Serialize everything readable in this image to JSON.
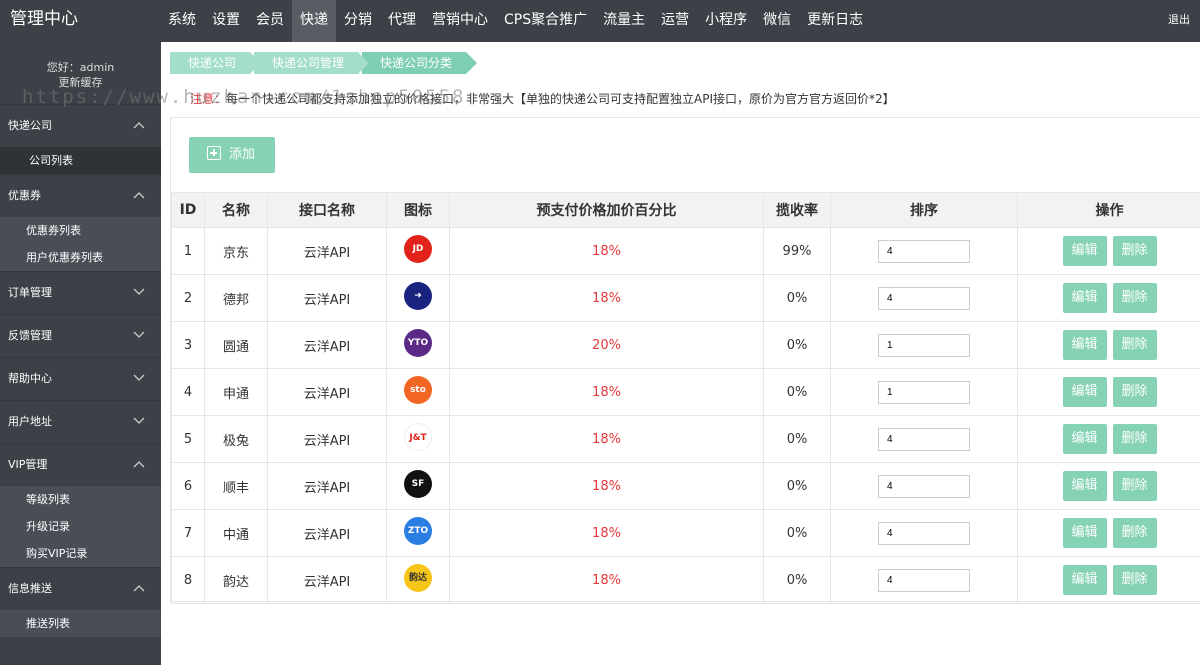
{
  "header": {
    "brand": "管理中心",
    "nav": [
      "系统",
      "设置",
      "会员",
      "快递",
      "分销",
      "代理",
      "营销中心",
      "CPS聚合推广",
      "流量主",
      "运营",
      "小程序",
      "微信",
      "更新日志"
    ],
    "active_nav": "快递",
    "logout": "退出"
  },
  "sidebar": {
    "greeting": "您好：admin",
    "clear_cache": "更新缓存",
    "groups": [
      {
        "label": "快递公司",
        "expanded": true,
        "items": [
          "公司列表"
        ]
      },
      {
        "label": "优惠券",
        "expanded": true,
        "items": [
          "优惠券列表",
          "用户优惠券列表"
        ]
      },
      {
        "label": "订单管理",
        "expanded": false,
        "items": []
      },
      {
        "label": "反馈管理",
        "expanded": false,
        "items": []
      },
      {
        "label": "帮助中心",
        "expanded": false,
        "items": []
      },
      {
        "label": "用户地址",
        "expanded": false,
        "items": []
      },
      {
        "label": "VIP管理",
        "expanded": true,
        "items": [
          "等级列表",
          "升级记录",
          "购买VIP记录"
        ]
      },
      {
        "label": "信息推送",
        "expanded": true,
        "items": [
          "推送列表"
        ]
      }
    ]
  },
  "breadcrumbs": [
    "快递公司",
    "快递公司管理",
    "快递公司分类"
  ],
  "notice": {
    "label": "注意：",
    "text": "每一个快递公司都支持添加独立的价格接口，非常强大【单独的快递公司可支持配置独立API接口，原价为官方官方返回价*2】"
  },
  "watermark": "https://www.huzhan.com/1shop50558",
  "toolbar": {
    "add_label": "添加"
  },
  "table": {
    "headers": [
      "ID",
      "名称",
      "接口名称",
      "图标",
      "预支付价格加价百分比",
      "揽收率",
      "排序",
      "操作"
    ],
    "edit_label": "编辑",
    "delete_label": "删除",
    "rows": [
      {
        "id": "1",
        "name": "京东",
        "api": "云洋API",
        "logo_text": "JD",
        "logo_color": "#e2231a",
        "markup": "18%",
        "rate": "99%",
        "sort": "4"
      },
      {
        "id": "2",
        "name": "德邦",
        "api": "云洋API",
        "logo_text": "➜",
        "logo_color": "#1a237e",
        "markup": "18%",
        "rate": "0%",
        "sort": "4"
      },
      {
        "id": "3",
        "name": "圆通",
        "api": "云洋API",
        "logo_text": "YTO",
        "logo_color": "#5b2a86",
        "markup": "20%",
        "rate": "0%",
        "sort": "1"
      },
      {
        "id": "4",
        "name": "申通",
        "api": "云洋API",
        "logo_text": "sto",
        "logo_color": "#f26522",
        "markup": "18%",
        "rate": "0%",
        "sort": "1"
      },
      {
        "id": "5",
        "name": "极兔",
        "api": "云洋API",
        "logo_text": "J&T",
        "logo_color": "#ffffff",
        "markup": "18%",
        "rate": "0%",
        "sort": "4"
      },
      {
        "id": "6",
        "name": "顺丰",
        "api": "云洋API",
        "logo_text": "SF",
        "logo_color": "#111111",
        "markup": "18%",
        "rate": "0%",
        "sort": "4"
      },
      {
        "id": "7",
        "name": "中通",
        "api": "云洋API",
        "logo_text": "ZTO",
        "logo_color": "#2a7de1",
        "markup": "18%",
        "rate": "0%",
        "sort": "4"
      },
      {
        "id": "8",
        "name": "韵达",
        "api": "云洋API",
        "logo_text": "韵达",
        "logo_color": "#f5c518",
        "markup": "18%",
        "rate": "0%",
        "sort": "4"
      }
    ]
  }
}
